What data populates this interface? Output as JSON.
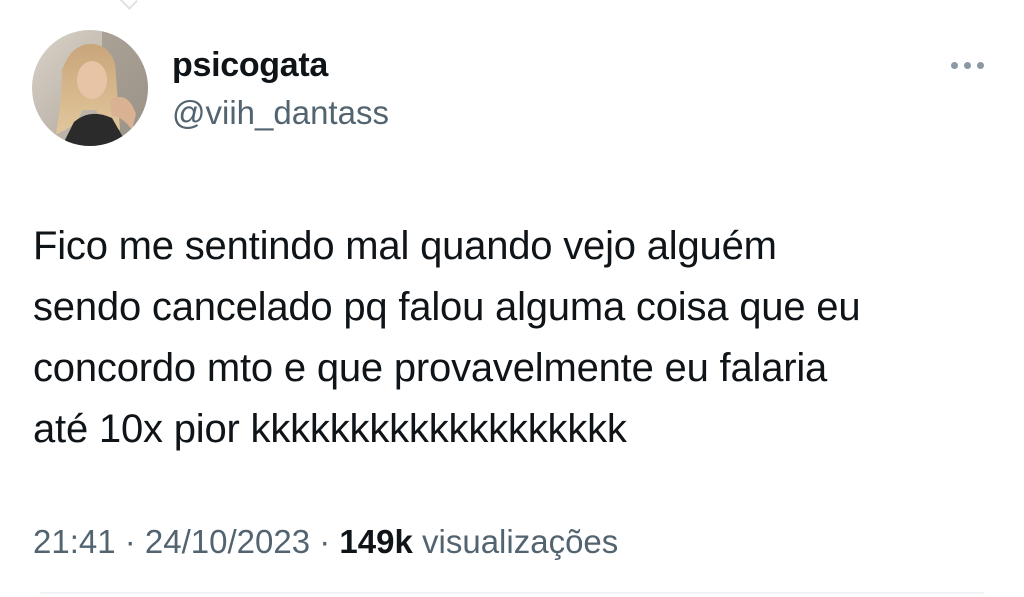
{
  "author": {
    "display_name": "psicogata",
    "handle": "@viih_dantass"
  },
  "tweet": {
    "text": "Fico me sentindo mal quando vejo alguém\nsendo cancelado pq falou alguma coisa que eu\nconcordo mto e que provavelmente eu falaria\naté 10x pior kkkkkkkkkkkkkkkkkkk"
  },
  "meta": {
    "time": "21:41",
    "separator": " · ",
    "date": "24/10/2023",
    "views_count": "149k",
    "views_label": " visualizações"
  },
  "icons": {
    "more": "more-horizontal-icon"
  },
  "colors": {
    "text_primary": "#0f1419",
    "text_secondary": "#536471",
    "background": "#ffffff"
  }
}
